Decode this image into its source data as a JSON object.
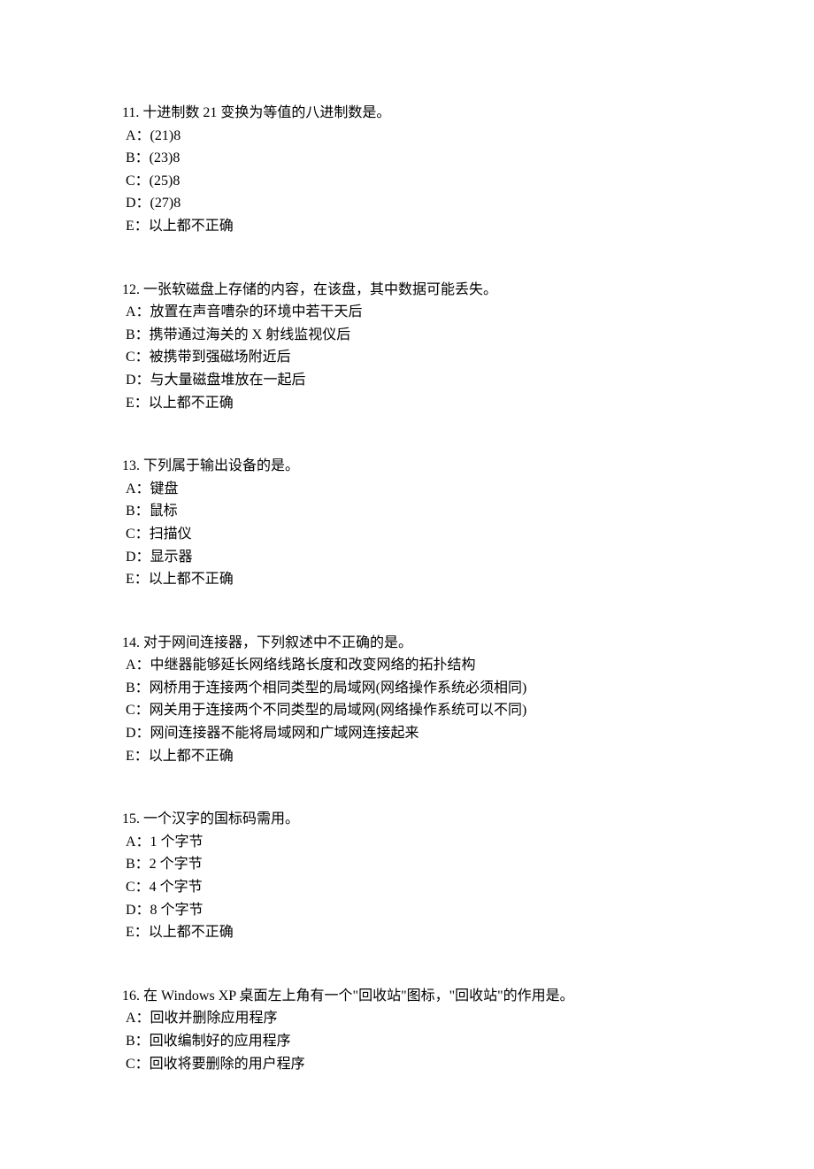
{
  "questions": [
    {
      "number": "11.",
      "text": "十进制数 21 变换为等值的八进制数是。",
      "options": [
        "A：(21)8",
        "B：(23)8",
        "C：(25)8",
        "D：(27)8",
        "E：以上都不正确"
      ]
    },
    {
      "number": "12.",
      "text": "一张软磁盘上存储的内容，在该盘，其中数据可能丢失。",
      "options": [
        "A：放置在声音嘈杂的环境中若干天后",
        "B：携带通过海关的 X 射线监视仪后",
        "C：被携带到强磁场附近后",
        "D：与大量磁盘堆放在一起后",
        "E：以上都不正确"
      ]
    },
    {
      "number": "13.",
      "text": "下列属于输出设备的是。",
      "options": [
        "A：键盘",
        "B：鼠标",
        "C：扫描仪",
        "D：显示器",
        "E：以上都不正确"
      ]
    },
    {
      "number": "14.",
      "text": "对于网间连接器，下列叙述中不正确的是。",
      "options": [
        "A：中继器能够延长网络线路长度和改变网络的拓扑结构",
        "B：网桥用于连接两个相同类型的局域网(网络操作系统必须相同)",
        "C：网关用于连接两个不同类型的局域网(网络操作系统可以不同)",
        "D：网间连接器不能将局域网和广域网连接起来",
        "E：以上都不正确"
      ]
    },
    {
      "number": "15.",
      "text": "一个汉字的国标码需用。",
      "options": [
        "A：1 个字节",
        "B：2 个字节",
        "C：4 个字节",
        "D：8 个字节",
        "E：以上都不正确"
      ]
    },
    {
      "number": "16.",
      "text": "在 Windows XP 桌面左上角有一个\"回收站\"图标，\"回收站\"的作用是。",
      "options": [
        "A：回收并删除应用程序",
        "B：回收编制好的应用程序",
        "C：回收将要删除的用户程序"
      ]
    }
  ]
}
